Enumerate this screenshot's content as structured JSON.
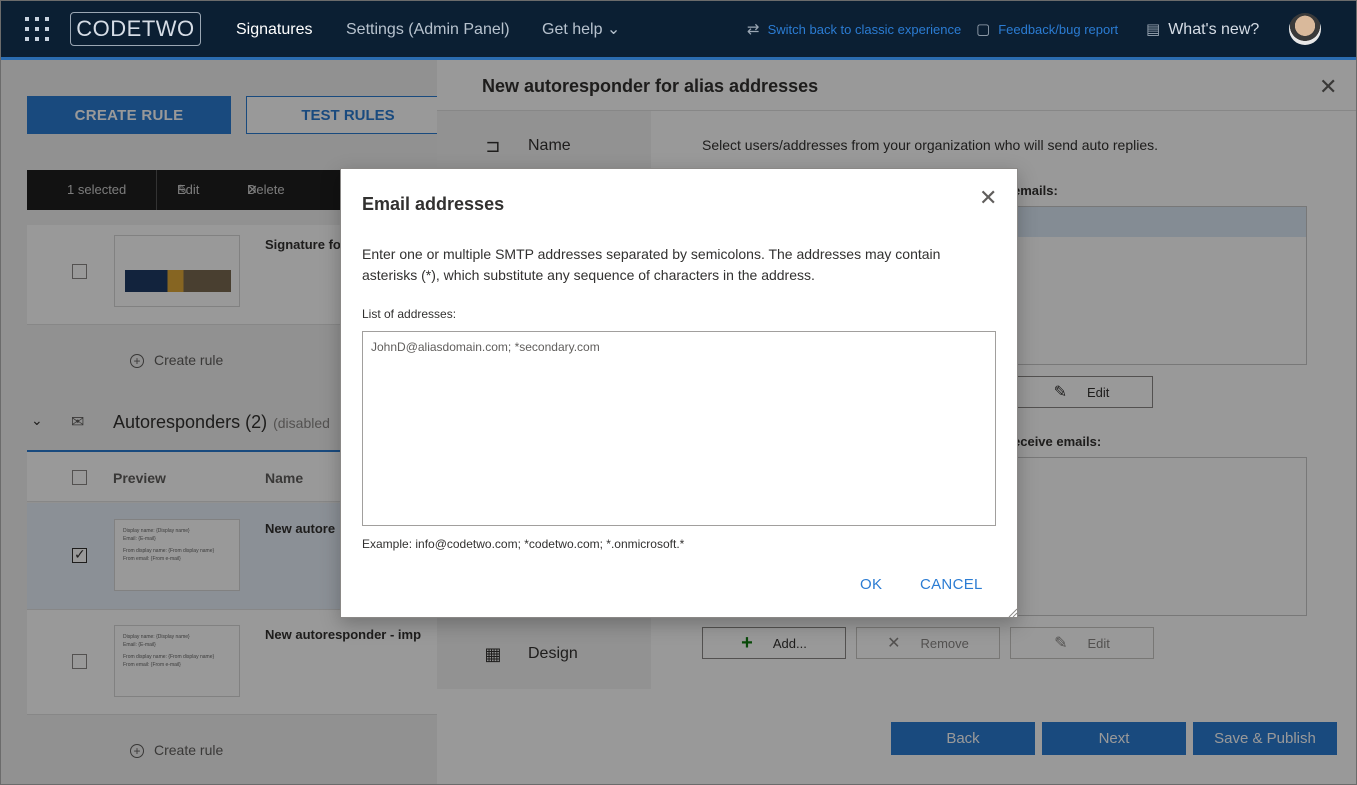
{
  "topbar": {
    "logo": "CODETWO",
    "nav": [
      {
        "label": "Signatures",
        "active": true
      },
      {
        "label": "Settings (Admin Panel)",
        "active": false
      },
      {
        "label": "Get help ⌄",
        "active": false
      }
    ],
    "links": {
      "classic": "Switch back to classic experience",
      "feedback": "Feedback/bug report",
      "whats_new": "What's new?"
    },
    "icons": [
      "waffle-icon",
      "switch-icon",
      "feedback-icon",
      "news-icon",
      "avatar"
    ]
  },
  "page": {
    "create_rule_btn": "CREATE RULE",
    "test_rules_btn": "TEST RULES",
    "actionbar": {
      "selected": "1 selected",
      "edit": "Edit",
      "delete": "Delete"
    },
    "signature_row_name": "Signature fo",
    "create_rule_link": "Create rule",
    "section": {
      "title": "Autoresponders (2)",
      "muted": "(disabled"
    },
    "columns": {
      "preview": "Preview",
      "name": "Name"
    },
    "rows": [
      {
        "name": "New autore",
        "checked": true,
        "thumb_lines": [
          "Display name: {Display name}",
          "Email: {E-mail}",
          "",
          "From display name: {From display name}",
          "From email: {From e-mail}"
        ]
      },
      {
        "name": "New autoresponder - imp",
        "checked": false,
        "thumb_lines": [
          "Display name: {Display name}",
          "Email: {E-mail}",
          "",
          "From display name: {From display name}",
          "From email: {From e-mail}"
        ]
      }
    ],
    "create_rule_link_2": "Create rule"
  },
  "panel": {
    "title": "New autoresponder for alias addresses",
    "steps": {
      "name": "Name",
      "design": "Design"
    },
    "instruction": "Select users/addresses from your organization who will send auto replies.",
    "label_senders": "emails:",
    "label_receivers": "eceive emails:",
    "buttons": {
      "edit": "Edit",
      "add": "Add...",
      "remove": "Remove"
    },
    "footer": {
      "back": "Back",
      "next": "Next",
      "save": "Save & Publish"
    }
  },
  "dialog": {
    "title": "Email addresses",
    "description": "Enter one or multiple SMTP addresses separated by semicolons. The addresses may contain asterisks (*), which substitute any sequence of characters in the address.",
    "list_label": "List of addresses:",
    "value": "JohnD@aliasdomain.com; *secondary.com",
    "example": "Example: info@codetwo.com; *codetwo.com; *.onmicrosoft.*",
    "ok": "OK",
    "cancel": "CANCEL"
  },
  "colors": {
    "accent": "#2b7cd3",
    "topbar": "#0b1f33",
    "green": "#107c10"
  }
}
